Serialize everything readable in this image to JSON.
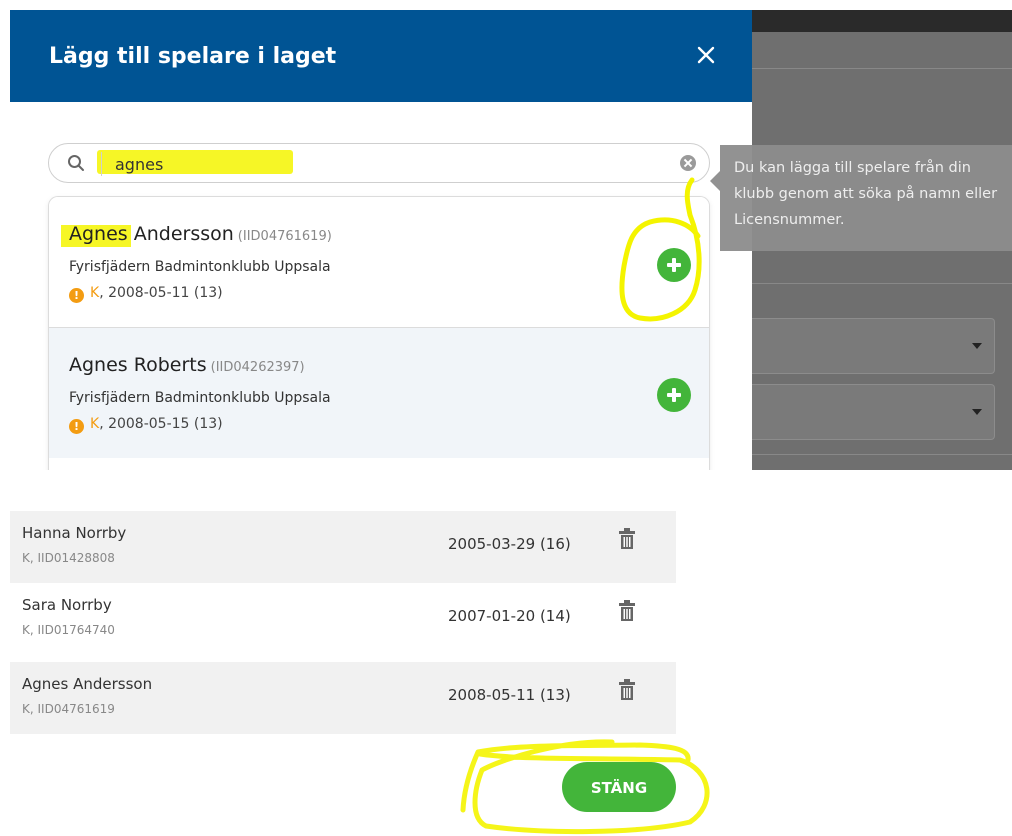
{
  "modal": {
    "title": "Lägg till spelare i laget",
    "close_icon": "close-icon"
  },
  "search": {
    "value": "agnes",
    "icon": "search-icon",
    "clear_icon": "clear-icon"
  },
  "results": [
    {
      "name": "Agnes Andersson",
      "id": "(IID04761619)",
      "club": "Fyrisfjädern Badmintonklubb Uppsala",
      "gender": "K",
      "birth": ", 2008-05-11 (13)"
    },
    {
      "name": "Agnes Roberts",
      "id": "(IID04262397)",
      "club": "Fyrisfjädern Badmintonklubb Uppsala",
      "gender": "K",
      "birth": ", 2008-05-15 (13)"
    }
  ],
  "tooltip": {
    "text": "Du kan lägga till spelare från din klubb genom att söka på namn eller Licensnummer."
  },
  "players": [
    {
      "name": "Hanna Norrby",
      "sub": "K, IID01428808",
      "date": "2005-03-29 (16)"
    },
    {
      "name": "Sara Norrby",
      "sub": "K, IID01764740",
      "date": "2007-01-20 (14)"
    },
    {
      "name": "Agnes Andersson",
      "sub": "K, IID04761619",
      "date": "2008-05-11 (13)"
    }
  ],
  "footer": {
    "close_label": "STÄNG"
  },
  "colors": {
    "header": "#005494",
    "accent_green": "#43b53a",
    "warning": "#f39c12",
    "highlight": "#f4f400"
  }
}
